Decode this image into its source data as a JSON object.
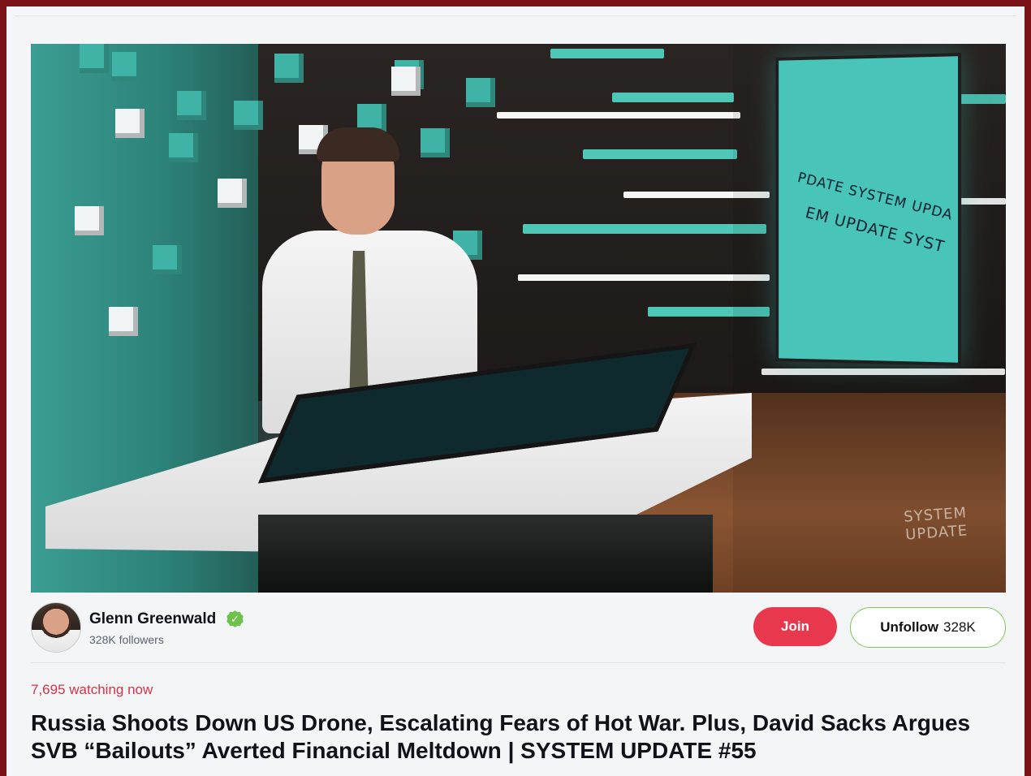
{
  "video": {
    "screen_text_line1": "PDATE SYSTEM UPDA",
    "screen_text_line2": "EM UPDATE SYST",
    "watermark_line1": "SYSTEM",
    "watermark_line2": "UPDATE"
  },
  "channel": {
    "name": "Glenn Greenwald",
    "verified_icon": "verified-check-icon",
    "followers": "328K followers",
    "join_label": "Join",
    "unfollow_label": "Unfollow",
    "unfollow_count": "328K"
  },
  "stream": {
    "watching": "7,695 watching now",
    "title": "Russia Shoots Down US Drone, Escalating Fears of Hot War. Plus, David Sacks Argues SVB “Bailouts” Averted Financial Meltdown | SYSTEM UPDATE #55"
  },
  "colors": {
    "accent_red": "#e8384d",
    "verified_green": "#6cc24a",
    "follow_border": "#7cc85b",
    "frame": "#7a1218"
  }
}
